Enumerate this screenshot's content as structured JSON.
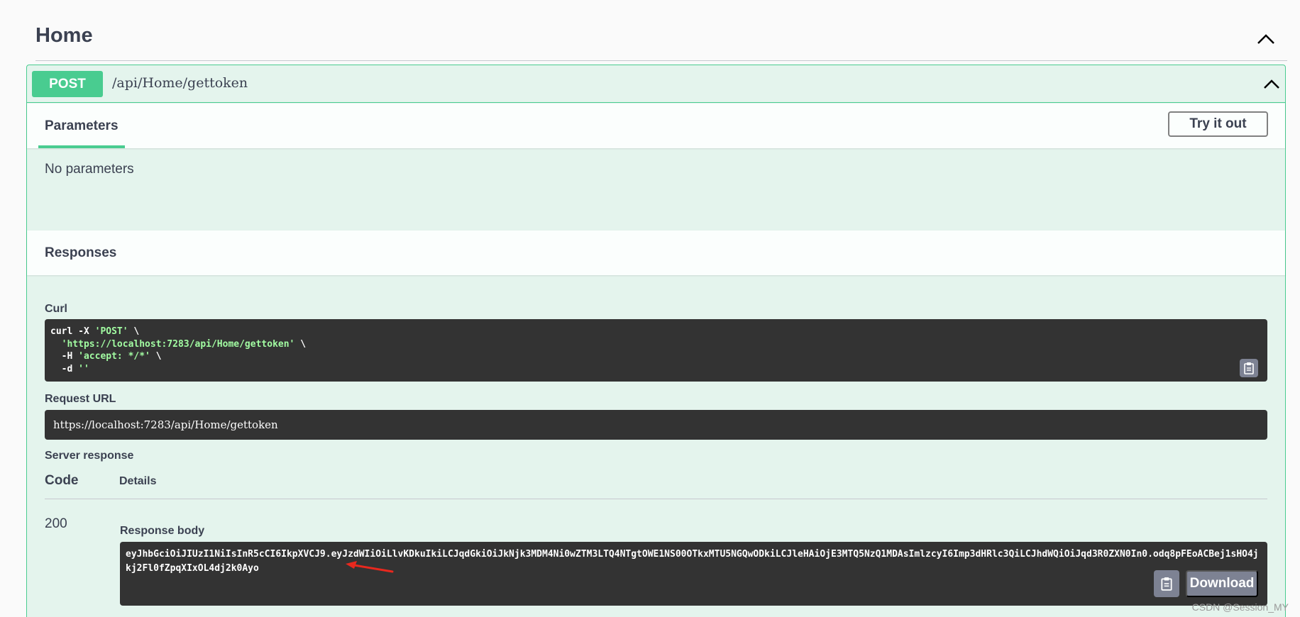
{
  "tag": {
    "title": "Home"
  },
  "operation": {
    "method": "POST",
    "path": "/api/Home/gettoken",
    "tab_parameters": "Parameters",
    "try_it_out": "Try it out",
    "no_parameters": "No parameters",
    "responses_title": "Responses"
  },
  "curl": {
    "label": "Curl",
    "line1_cmd": "curl -X ",
    "line1_str": "'POST'",
    "line1_end": " \\",
    "line2_str": "  'https://localhost:7283/api/Home/gettoken'",
    "line2_end": " \\",
    "line3_cmd": "  -H ",
    "line3_str": "'accept: */*'",
    "line3_end": " \\",
    "line4_cmd": "  -d ",
    "line4_str": "''"
  },
  "request_url": {
    "label": "Request URL",
    "value": "https://localhost:7283/api/Home/gettoken"
  },
  "server_response": {
    "label": "Server response",
    "col_code": "Code",
    "col_details": "Details",
    "code": "200",
    "body_label": "Response body",
    "body": "eyJhbGciOiJIUzI1NiIsInR5cCI6IkpXVCJ9.eyJzdWIiOiLlvKDkuIkiLCJqdGkiOiJkNjk3MDM4Ni0wZTM3LTQ4NTgtOWE1NS00OTkxMTU5NGQwODkiLCJleHAiOjE3MTQ5NzQ1MDAsImlzcyI6Imp3dHRlc3QiLCJhdWQiOiJqd3R0ZXN0In0.odq8pFEoACBej1sHO4jkj2Fl0fZpqXIxOL4dj2k0Ayo",
    "download": "Download"
  },
  "watermark": "CSDN @Session_MY",
  "colors": {
    "post": "#49cc90",
    "code_bg": "#333333",
    "button_grey": "#7d8293"
  }
}
